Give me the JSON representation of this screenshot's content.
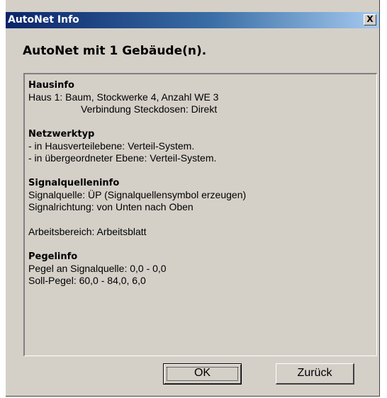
{
  "window": {
    "title": "AutoNet Info",
    "close_label": "X"
  },
  "heading": "AutoNet mit 1 Gebäude(n).",
  "info": {
    "hausinfo": {
      "title": "Hausinfo",
      "line1": "Haus 1: Baum, Stockwerke 4, Anzahl WE 3",
      "line2": "Verbindung Steckdosen: Direkt"
    },
    "netzwerktyp": {
      "title": "Netzwerktyp",
      "line1": "- in Hausverteilebene: Verteil-System.",
      "line2": "- in übergeordneter Ebene: Verteil-System."
    },
    "signalquelleninfo": {
      "title": "Signalquelleninfo",
      "line1": "Signalquelle: ÜP (Signalquellensymbol erzeugen)",
      "line2": "Signalrichtung: von Unten nach Oben"
    },
    "arbeitsbereich": "Arbeitsbereich: Arbeitsblatt",
    "pegelinfo": {
      "title": "Pegelinfo",
      "line1": "Pegel an Signalquelle: 0,0 - 0,0",
      "line2": "Soll-Pegel: 60,0 - 84,0, 6,0"
    }
  },
  "buttons": {
    "ok": "OK",
    "back": "Zurück"
  }
}
